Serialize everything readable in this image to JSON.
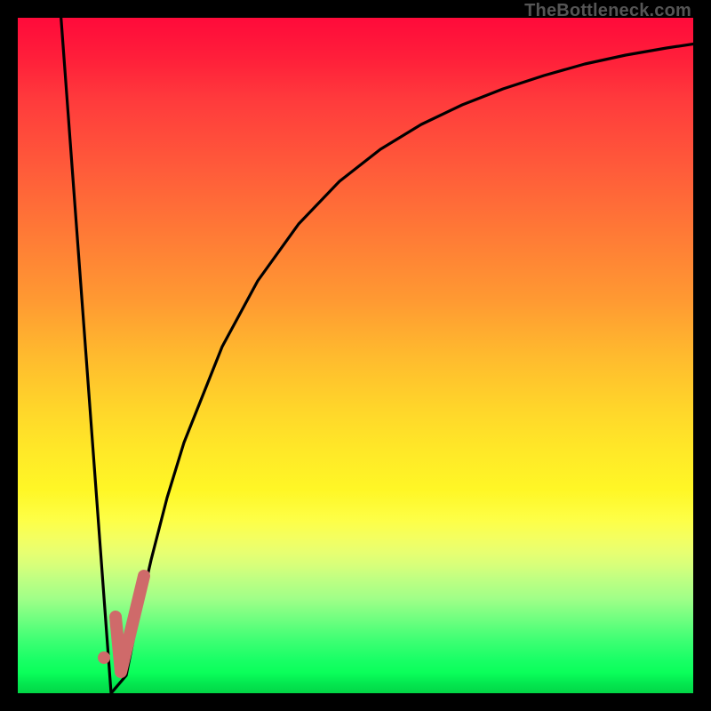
{
  "watermark": "TheBottleneck.com",
  "colors": {
    "frame": "#000000",
    "curve": "#000000",
    "marker_fill": "#cf6a6a",
    "marker_stroke": "#cf6a6a"
  },
  "chart_data": {
    "type": "line",
    "title": "",
    "xlabel": "",
    "ylabel": "",
    "xlim": [
      0,
      100
    ],
    "ylim": [
      0,
      100
    ],
    "grid": false,
    "legend": false,
    "notes": "Gradient background encodes bottleneck severity (green=good, red=bad). Black curve shows bottleneck% vs component ratio. Pink marker = user's configuration.",
    "series": [
      {
        "name": "bottleneck-curve",
        "x": [
          0,
          2,
          4,
          6,
          8,
          10,
          12,
          13.8,
          15,
          16,
          18,
          20,
          22,
          24,
          26,
          30,
          35,
          40,
          45,
          50,
          55,
          60,
          65,
          70,
          75,
          80,
          85,
          90,
          95,
          100
        ],
        "y": [
          115,
          100,
          84,
          68,
          52,
          36,
          20,
          0,
          2,
          6,
          16,
          26,
          35,
          43,
          50,
          61,
          71,
          78,
          83,
          87,
          90,
          92.5,
          94.5,
          96,
          97.2,
          98.1,
          98.8,
          99.3,
          99.7,
          100
        ]
      }
    ],
    "marker": {
      "name": "user-selection",
      "point": {
        "x": 12.8,
        "y": 5
      },
      "tick_path": [
        {
          "x": 14.5,
          "y": 11
        },
        {
          "x": 15.2,
          "y": 3
        },
        {
          "x": 18.6,
          "y": 17
        }
      ]
    }
  }
}
